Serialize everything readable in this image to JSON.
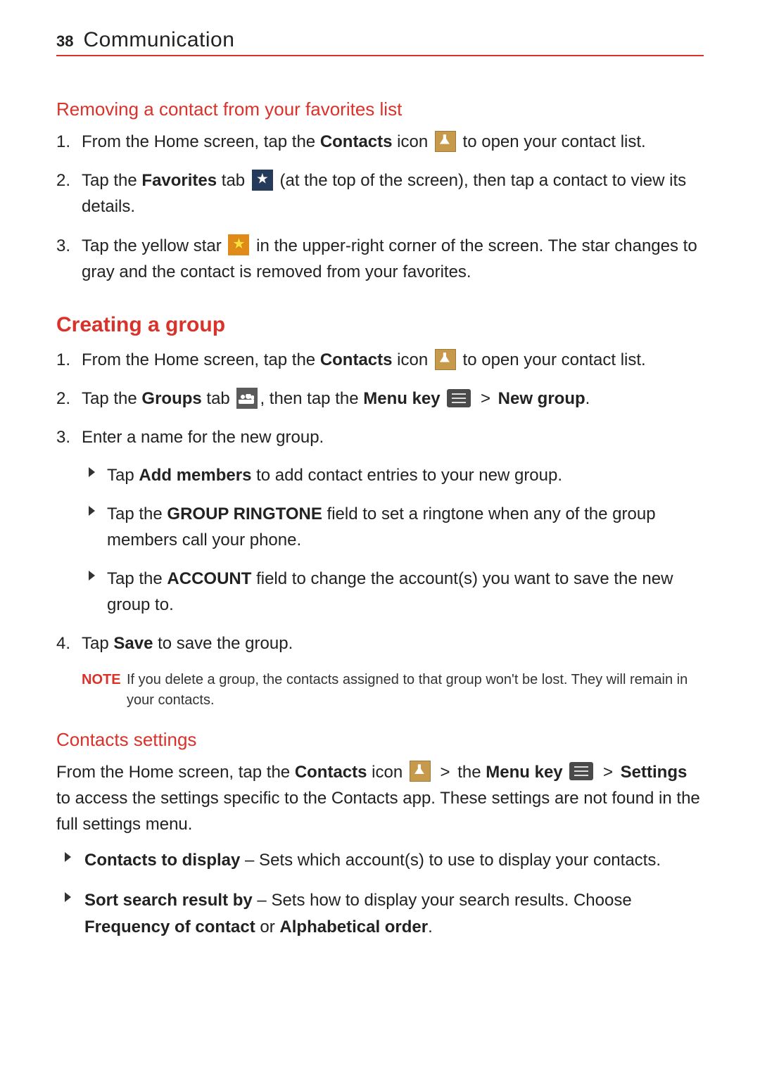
{
  "header": {
    "page_number": "38",
    "title": "Communication"
  },
  "section_removing": {
    "heading": "Removing a contact from your favorites list",
    "step1_a": "From the Home screen, tap the ",
    "step1_bold": "Contacts",
    "step1_b": " icon ",
    "step1_c": " to open your contact list.",
    "step2_a": "Tap the ",
    "step2_bold": "Favorites",
    "step2_b": " tab ",
    "step2_c": " (at the top of the screen), then tap a contact to view its details.",
    "step3_a": "Tap the yellow star ",
    "step3_b": " in the upper-right corner of the screen. The star changes to gray and the contact is removed from your favorites."
  },
  "section_creating": {
    "heading": "Creating a group",
    "step1_a": "From the Home screen, tap the ",
    "step1_bold": "Contacts",
    "step1_b": " icon ",
    "step1_c": " to open your contact list.",
    "step2_a": "Tap the ",
    "step2_bold1": "Groups",
    "step2_b": " tab ",
    "step2_c": ", then tap the ",
    "step2_bold2": "Menu key",
    "step2_gt": " > ",
    "step2_bold3": "New group",
    "step2_d": ".",
    "step3": "Enter a name for the new group.",
    "sub1_a": "Tap ",
    "sub1_bold": "Add members",
    "sub1_b": " to add contact entries to your new group.",
    "sub2_a": "Tap the ",
    "sub2_bold": "GROUP RINGTONE",
    "sub2_b": " field to set a ringtone when any of the group members call your phone.",
    "sub3_a": "Tap the ",
    "sub3_bold": "ACCOUNT",
    "sub3_b": " field to change the account(s) you want to save the new group to.",
    "step4_a": "Tap ",
    "step4_bold": "Save",
    "step4_b": " to save the group.",
    "note_label": "NOTE",
    "note_text": "If you delete a group, the contacts assigned to that group won't be lost. They will remain in your contacts."
  },
  "section_settings": {
    "heading": "Contacts settings",
    "intro_a": "From the Home screen, tap the ",
    "intro_bold1": "Contacts",
    "intro_b": " icon ",
    "intro_gt1": " > ",
    "intro_c": "the ",
    "intro_bold2": "Menu key",
    "intro_gt2": " > ",
    "intro_bold3": "Settings",
    "intro_d": " to access the settings specific to the Contacts app. These settings are not found in the full settings menu.",
    "item1_bold": "Contacts to display",
    "item1_text": " – Sets which account(s) to use to display your contacts.",
    "item2_bold": "Sort search result by",
    "item2_text1": " – Sets how to display your search results. Choose ",
    "item2_bold2": "Frequency of contact",
    "item2_text2": " or ",
    "item2_bold3": "Alphabetical order",
    "item2_text3": "."
  }
}
